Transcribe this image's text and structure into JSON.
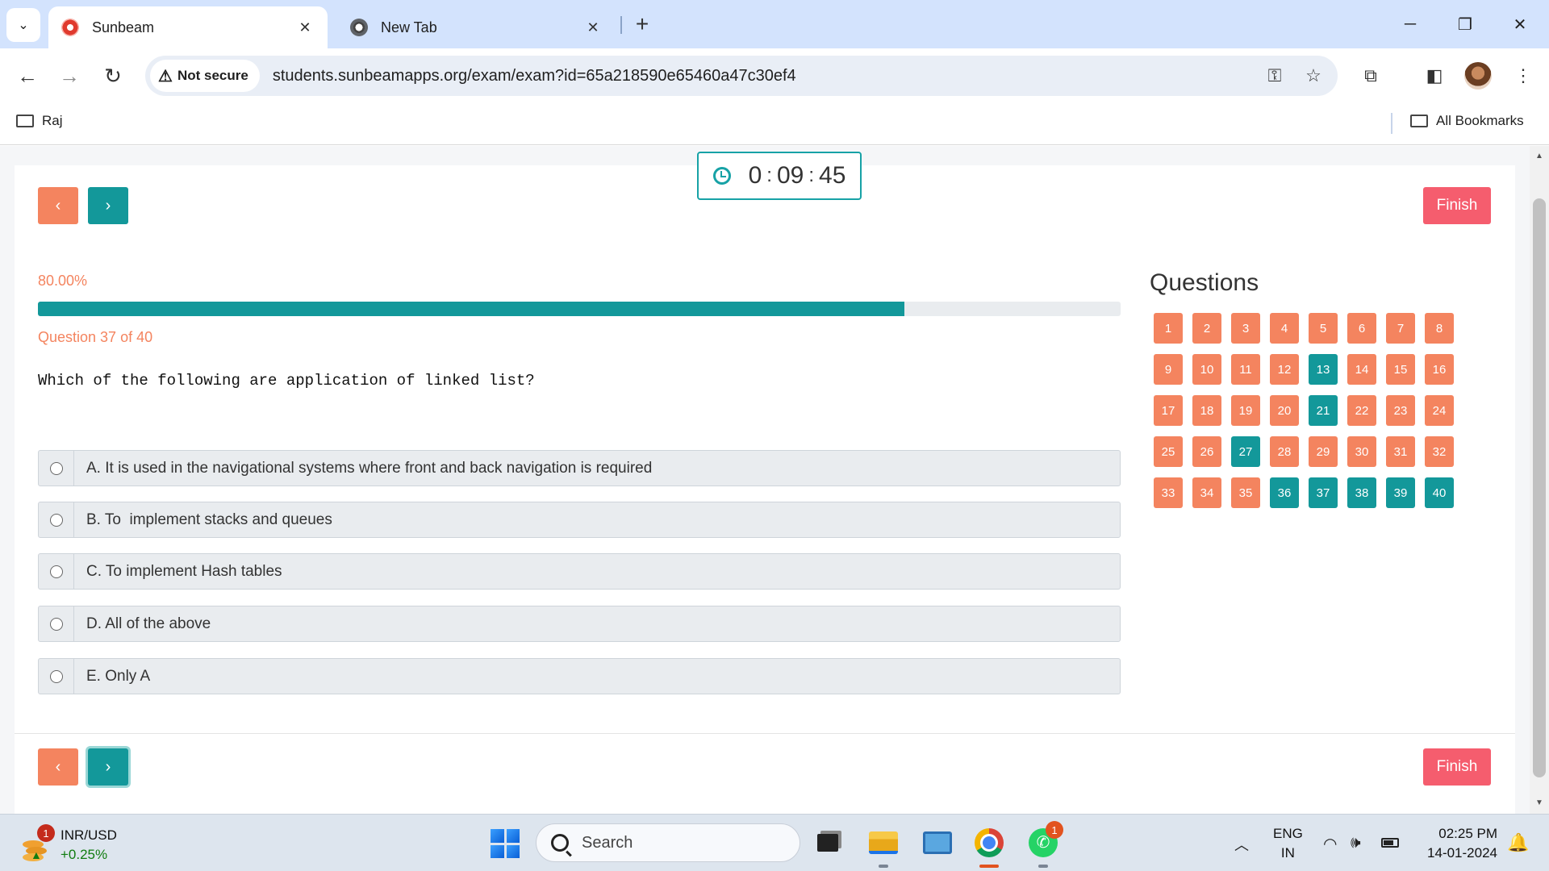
{
  "browser": {
    "tabs": [
      {
        "title": "Sunbeam",
        "active": true
      },
      {
        "title": "New Tab",
        "active": false
      }
    ],
    "omnibox": {
      "security_label": "Not secure",
      "url": "students.sunbeamapps.org/exam/exam?id=65a218590e65460a47c30ef4"
    },
    "bookmarks": {
      "left_folder": "Raj",
      "right_folder": "All Bookmarks"
    }
  },
  "exam": {
    "timer": {
      "h": "0",
      "m": "09",
      "s": "45"
    },
    "nav": {
      "prev_icon": "‹",
      "next_icon": "›",
      "finish_label": "Finish"
    },
    "progress": {
      "label": "80.00%",
      "fraction": 0.8
    },
    "question_counter": "Question 37 of 40",
    "question_text": "Which of the following are application of linked list?",
    "options": [
      {
        "label": "A. It is used in the navigational systems where front and back navigation is required"
      },
      {
        "label": "B. To  implement stacks and queues"
      },
      {
        "label": "C. To implement Hash tables"
      },
      {
        "label": "D. All of the above"
      },
      {
        "label": "E. Only A"
      }
    ],
    "questions_panel": {
      "heading": "Questions",
      "numbers": [
        "1",
        "2",
        "3",
        "4",
        "5",
        "6",
        "7",
        "8",
        "9",
        "10",
        "11",
        "12",
        "13",
        "14",
        "15",
        "16",
        "17",
        "18",
        "19",
        "20",
        "21",
        "22",
        "23",
        "24",
        "25",
        "26",
        "27",
        "28",
        "29",
        "30",
        "31",
        "32",
        "33",
        "34",
        "35",
        "36",
        "37",
        "38",
        "39",
        "40"
      ],
      "teal_numbers": [
        "13",
        "21",
        "27",
        "36",
        "37",
        "38",
        "39",
        "40"
      ]
    },
    "colors": {
      "orange": "#f4845f",
      "teal": "#13989a",
      "finish": "#f55d6e"
    }
  },
  "taskbar": {
    "ticker_name": "INR/USD",
    "ticker_change": "+0.25%",
    "weather_badge": "1",
    "search_placeholder": "Search",
    "whatsapp_badge": "1",
    "lang_top": "ENG",
    "lang_bottom": "IN",
    "time": "02:25 PM",
    "date": "14-01-2024"
  }
}
